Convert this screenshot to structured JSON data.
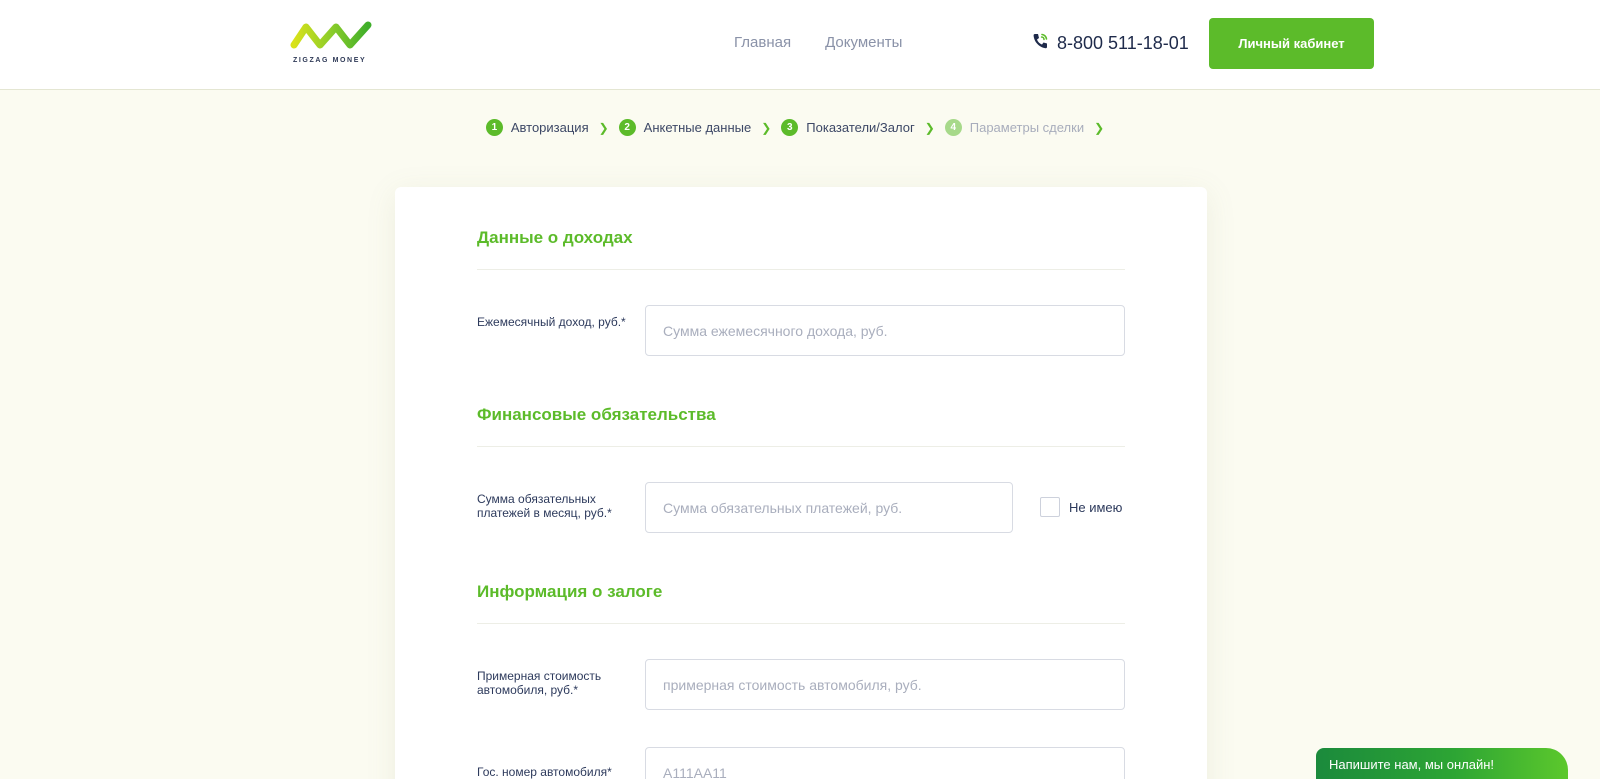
{
  "brand": {
    "logo_text": "ZIGZAG MONEY",
    "accent": "#5cbb2a"
  },
  "header": {
    "nav": [
      "Главная",
      "Документы"
    ],
    "phone": "8-800 511-18-01",
    "cabinet_button": "Личный кабинет"
  },
  "steps": [
    {
      "num": "1",
      "label": "Авторизация",
      "active": true
    },
    {
      "num": "2",
      "label": "Анкетные данные",
      "active": true
    },
    {
      "num": "3",
      "label": "Показатели/Залог",
      "active": true
    },
    {
      "num": "4",
      "label": "Параметры сделки",
      "active": false
    }
  ],
  "income": {
    "title": "Данные о доходах",
    "label": "Ежемесячный доход, руб.*",
    "placeholder": "Сумма ежемесячного дохода, руб."
  },
  "obligations": {
    "title": "Финансовые обязательства",
    "label": "Сумма обязательных платежей в месяц, руб.*",
    "placeholder": "Сумма обязательных платежей, руб.",
    "checkbox_label": "Не имею"
  },
  "collateral": {
    "title": "Информация о залоге",
    "price_label": "Примерная стоимость автомобиля, руб.*",
    "price_placeholder": "примерная стоимость автомобиля, руб.",
    "plate_label": "Гос. номер автомобиля*",
    "plate_placeholder": "А111АА11"
  },
  "chat": {
    "label": "Напишите нам, мы онлайн!"
  }
}
